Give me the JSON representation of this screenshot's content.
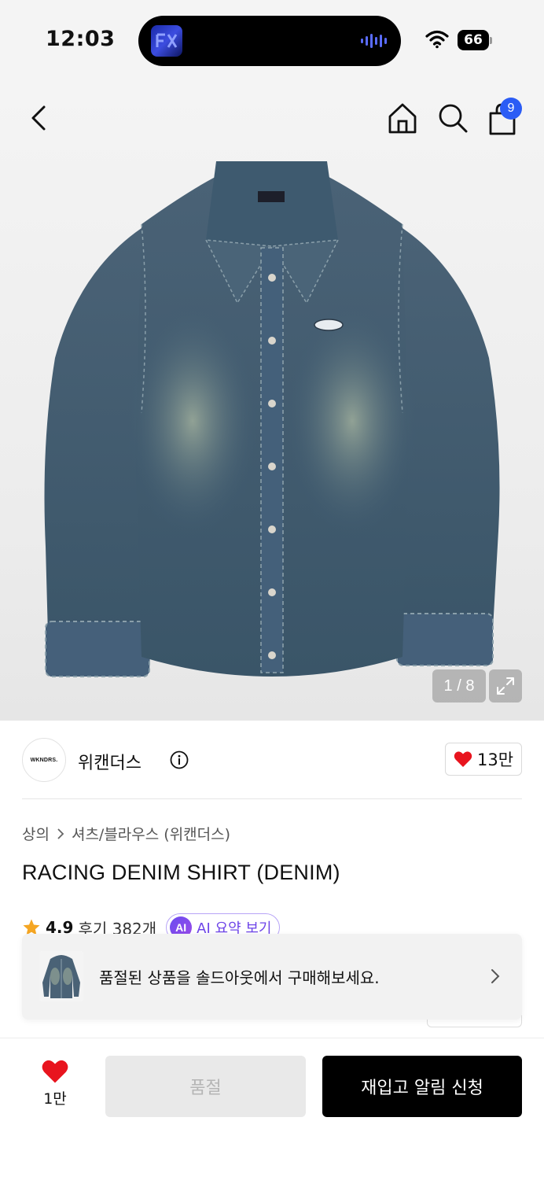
{
  "status_bar": {
    "time": "12:03",
    "battery": "66",
    "icons": [
      "wifi-icon",
      "battery-icon"
    ]
  },
  "nav": {
    "icons": [
      "back-icon",
      "home-icon",
      "search-icon",
      "shopping-bag-icon"
    ],
    "cart_badge": "9"
  },
  "gallery": {
    "counter": "1 / 8",
    "expand_icon": "expand-icon"
  },
  "brand": {
    "logo_text": "WKNDRS.",
    "name": "위캔더스",
    "likes": "13만"
  },
  "breadcrumb": {
    "level1": "상의",
    "level2": "셔츠/블라우스 (위캔더스)"
  },
  "product": {
    "title": "RACING DENIM SHIRT (DENIM)"
  },
  "rating": {
    "value": "4.9",
    "reviews": "후기 382개",
    "ai_badge": "AI",
    "ai_label": "AI 요약 보기"
  },
  "soldout_banner": {
    "text": "품절된 상품을 솔드아웃에서 구매해보세요."
  },
  "bottom_bar": {
    "wish_count": "1만",
    "soldout_label": "품절",
    "restock_label": "재입고 알림 신청"
  },
  "colors": {
    "accent_blue": "#2b5cf5",
    "heart_red": "#e8141e",
    "ai_purple": "#6d44e8",
    "primary_button": "#000000"
  }
}
